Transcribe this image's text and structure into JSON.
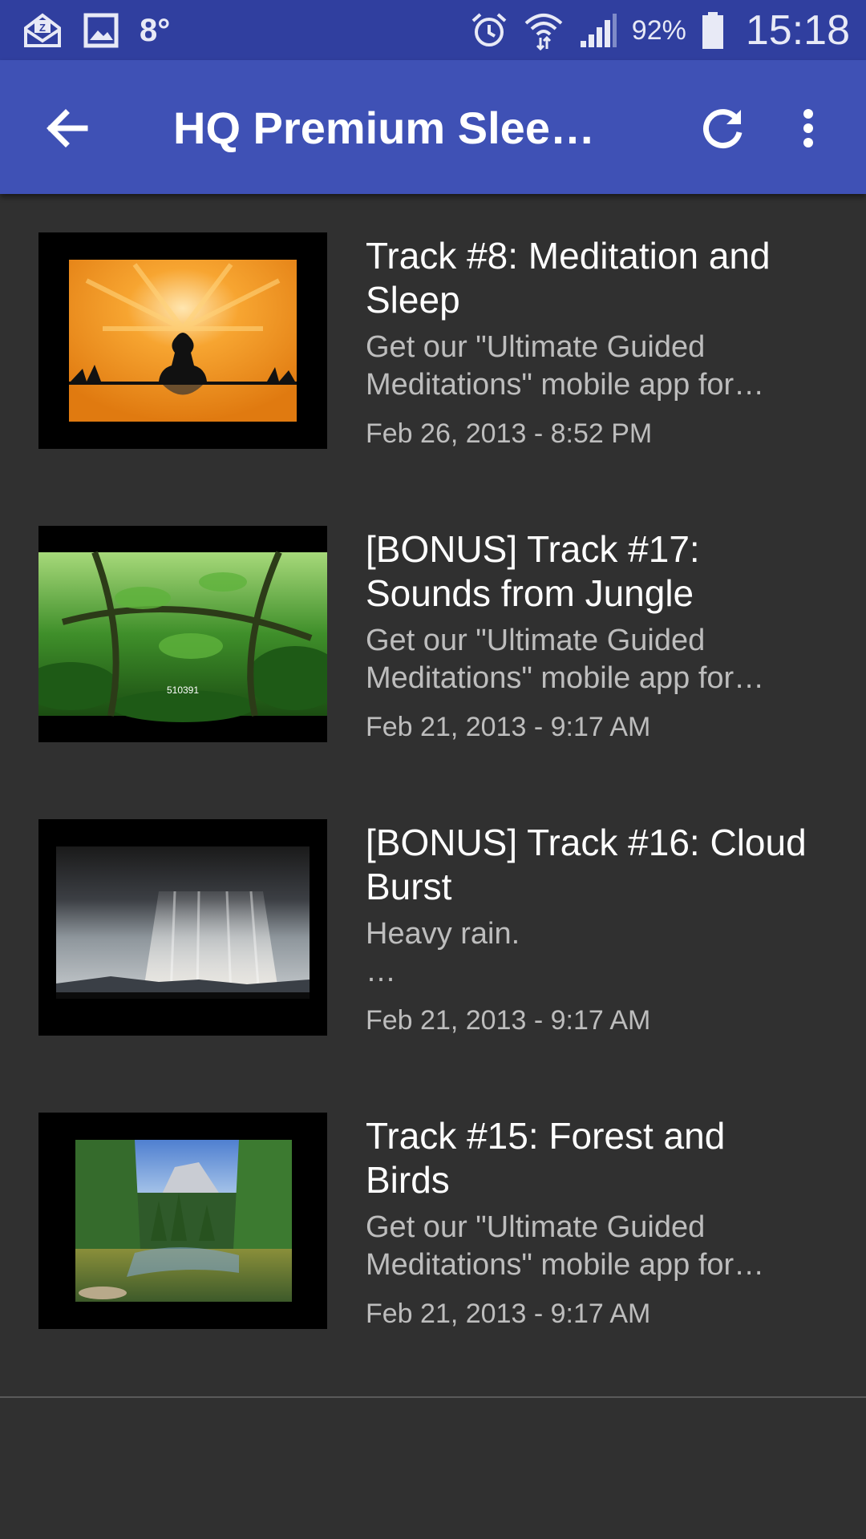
{
  "status_bar": {
    "temperature": "8°",
    "battery": "92%",
    "time": "15:18",
    "icons": [
      "email-icon",
      "image-icon",
      "alarm-icon",
      "wifi-icon",
      "signal-icon",
      "battery-icon"
    ]
  },
  "app_bar": {
    "title": "HQ Premium Sleep…",
    "icons": [
      "back-arrow-icon",
      "refresh-icon",
      "more-vert-icon"
    ]
  },
  "tracks": [
    {
      "title": "Track #8: Meditation and Sleep",
      "description": "Get our \"Ultimate Guided Meditations\" mobile app for…",
      "date": "Feb 26, 2013 - 8:52 PM"
    },
    {
      "title": "[BONUS] Track #17: Sounds from Jungle",
      "description": "Get our \"Ultimate Guided Meditations\" mobile app for…",
      "date": "Feb 21, 2013 - 9:17 AM",
      "thumbnail_text": "510391"
    },
    {
      "title": "[BONUS] Track #16: Cloud Burst",
      "description": "Heavy rain.\n…",
      "date": "Feb 21, 2013 - 9:17 AM"
    },
    {
      "title": "Track #15: Forest and Birds",
      "description": "Get our \"Ultimate Guided Meditations\" mobile app for…",
      "date": "Feb 21, 2013 - 9:17 AM"
    }
  ],
  "colors": {
    "status_bar": "#303f9f",
    "app_bar": "#3f51b5",
    "background": "#303030"
  }
}
